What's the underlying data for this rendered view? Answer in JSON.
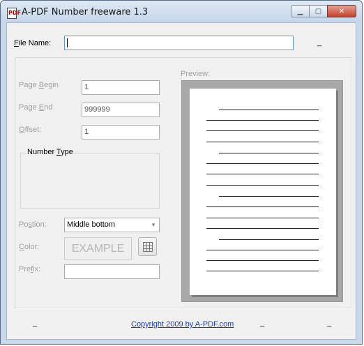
{
  "window": {
    "title": "A-PDF Number freeware 1.3",
    "icon": "app-document-icon",
    "icon_glyph": "PDF",
    "controls": {
      "minimize": "minimize-icon",
      "maximize": "maximize-icon",
      "close": "close-icon"
    }
  },
  "file": {
    "label_prefix": "",
    "label_accel": "F",
    "label_rest": "ile Name:",
    "value": "",
    "extra": "_"
  },
  "fields": {
    "page_begin": {
      "label_a": "Page ",
      "label_accel": "B",
      "label_b": "egin",
      "value": "1"
    },
    "page_end": {
      "label_a": "Page ",
      "label_accel": "E",
      "label_b": "nd",
      "value": "999999"
    },
    "offset": {
      "label_a": "",
      "label_accel": "O",
      "label_b": "ffset:",
      "value": "1"
    }
  },
  "number_type": {
    "label_a": "Number ",
    "label_accel": "T",
    "label_b": "ype"
  },
  "position": {
    "label_a": "Po",
    "label_accel": "s",
    "label_b": "tion:",
    "value": "Middle bottom"
  },
  "color": {
    "label_a": "",
    "label_accel": "C",
    "label_b": "olor:",
    "example": "EXAMPLE",
    "picker_icon": "grid-icon"
  },
  "prefix": {
    "label_a": "Pre",
    "label_accel": "f",
    "label_b": "ix:",
    "value": ""
  },
  "preview": {
    "label": "Preview:"
  },
  "footer": {
    "link": "Copyright 2009 by A-PDF.com",
    "marks": [
      "_",
      "_",
      "_"
    ]
  },
  "colors": {
    "link": "#1a3fb5",
    "disabled_text": "#a0a0a0",
    "preview_bg": "#a8a8a8"
  }
}
